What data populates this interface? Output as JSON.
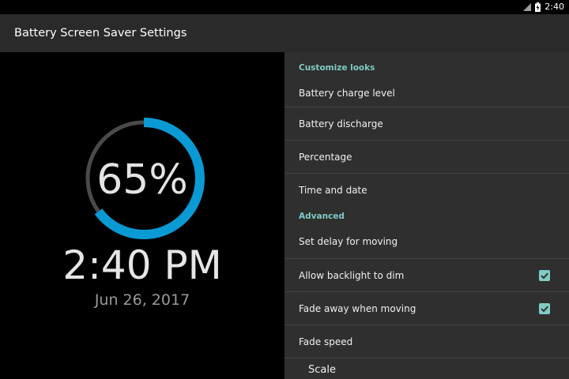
{
  "status_bar": {
    "time": "2:40",
    "icons": [
      "signal-icon",
      "battery-charging-icon"
    ]
  },
  "app_bar": {
    "title": "Battery Screen Saver Settings"
  },
  "preview": {
    "percent_text": "65%",
    "charge_level": 0.65,
    "time": "2:40 PM",
    "date": "Jun 26, 2017",
    "colors": {
      "charge_arc": "#0a9ad3",
      "remaining_arc": "#4a4a4a",
      "background": "#000000"
    }
  },
  "settings": {
    "customize_header": "Customize looks",
    "battery_charge_level": "Battery charge level",
    "battery_discharge": "Battery discharge",
    "percentage": "Percentage",
    "time_and_date": "Time and date",
    "advanced_header": "Advanced",
    "set_delay": "Set delay for moving",
    "allow_backlight_dim": {
      "label": "Allow backlight to dim",
      "checked": true
    },
    "fade_away_moving": {
      "label": "Fade away when moving",
      "checked": true
    },
    "fade_speed": "Fade speed",
    "scale": "Scale",
    "accent_color": "#80cbc4"
  }
}
